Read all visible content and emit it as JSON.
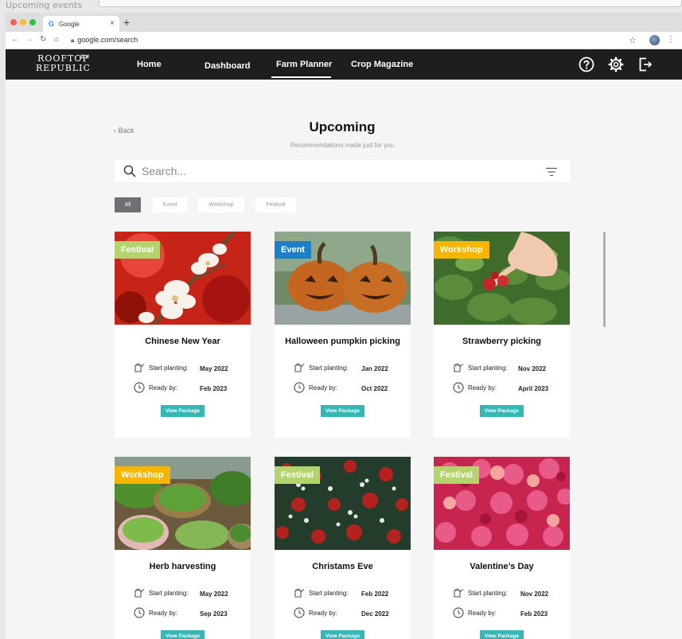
{
  "frame": {
    "title": "Upcoming events"
  },
  "browser": {
    "tab_label": "Google",
    "tab_icon": "google-g-icon",
    "url": "google.com/search"
  },
  "colors": {
    "nav_bg": "#1e1e1e",
    "accent_teal": "#33b8b6",
    "festival": "#b3d36d",
    "event": "#1f7fc6",
    "workshop": "#f7b500"
  },
  "nav": {
    "logo_line1": "ROOFTOP",
    "logo_line2": "REPUBLIC",
    "logo_cn": "雲 耕 ⺀",
    "links": [
      "Home",
      "Dashboard",
      "Farm Planner",
      "Crop Magazine"
    ],
    "active": "Farm Planner",
    "icons": [
      "help-icon",
      "settings-icon",
      "logout-icon"
    ]
  },
  "page": {
    "back_label": "Back",
    "title": "Upcoming",
    "subtitle": "Recommendations made just for you",
    "search_placeholder": "Search...",
    "filters": [
      "All",
      "Event",
      "Workshop",
      "Festival"
    ],
    "active_filter": "All"
  },
  "cards": [
    {
      "badge": "Festival",
      "title": "Chinese New Year",
      "start_label": "Start planting:",
      "start": "May 2022",
      "ready_label": "Ready by:",
      "ready": "Feb 2023",
      "button": "View Package"
    },
    {
      "badge": "Event",
      "title": "Halloween pumpkin picking",
      "start_label": "Start planting:",
      "start": "Jan 2022",
      "ready_label": "Ready by:",
      "ready": "Oct 2022",
      "button": "View Package"
    },
    {
      "badge": "Workshop",
      "title": "Strawberry picking",
      "start_label": "Start planting:",
      "start": "Nov 2022",
      "ready_label": "Ready by:",
      "ready": "April 2023",
      "button": "View Package"
    },
    {
      "badge": "Workshop",
      "title": "Herb harvesting",
      "start_label": "Start planting:",
      "start": "May 2022",
      "ready_label": "Ready by:",
      "ready": "Sep 2023",
      "button": "View Package"
    },
    {
      "badge": "Festival",
      "title": "Christams Eve",
      "start_label": "Start planting:",
      "start": "Feb 2022",
      "ready_label": "Ready by:",
      "ready": "Dec 2022",
      "button": "View Package"
    },
    {
      "badge": "Festival",
      "title": "Valentine’s Day",
      "start_label": "Start planting:",
      "start": "Nov 2022",
      "ready_label": "Ready by:",
      "ready": "Feb 2023",
      "button": "View Package"
    }
  ]
}
